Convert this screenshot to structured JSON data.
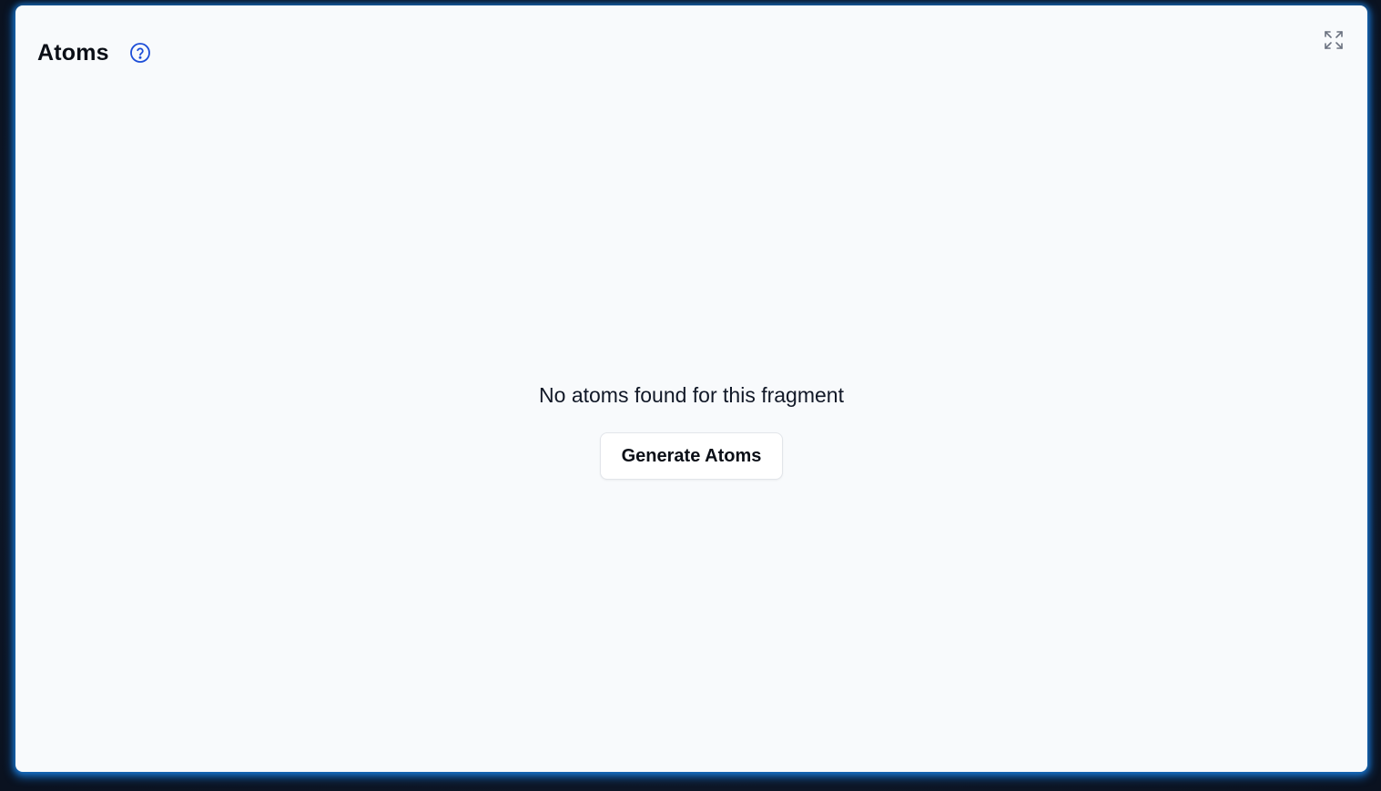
{
  "panel": {
    "title": "Atoms",
    "help_icon": "help-circle-icon",
    "expand_icon": "maximize-icon"
  },
  "empty_state": {
    "message": "No atoms found for this fragment",
    "button_label": "Generate Atoms"
  },
  "colors": {
    "accent": "#1d4ed8",
    "panel_background": "#f8fafc",
    "glow": "#1e82dc",
    "backdrop": "#0f1a2b"
  }
}
